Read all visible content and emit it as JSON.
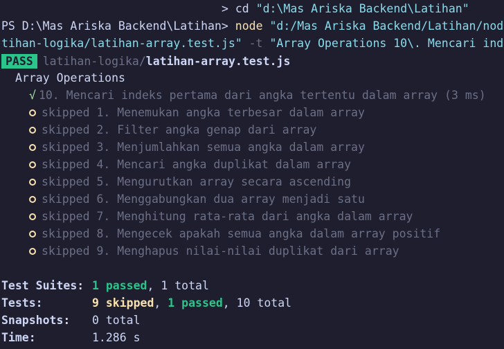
{
  "prompt": {
    "line1_cmd": "> cd",
    "line1_arg": "\"d:\\Mas Ariska Backend\\Latihan\"",
    "ps_prompt": "PS D:\\Mas Ariska Backend\\Latihan>",
    "node_cmd": "node",
    "node_arg": "\"d:/Mas Ariska Backend/Latihan/nod",
    "wrap_arg": "tihan-logika/latihan-array.test.js\"",
    "flag": " -t ",
    "flag_arg": "\"Array Operations 10\\. Mencari ind"
  },
  "result": {
    "badge": "PASS",
    "path_dir": "latihan-logika/",
    "path_file": "latihan-array.test.js",
    "suite_name": "Array Operations",
    "passed_test": "10. Mencari indeks pertama dari angka tertentu dalam array (3 ms)",
    "check_glyph": "√",
    "skipped_prefix": "skipped",
    "skipped_tests": [
      "1. Menemukan angka terbesar dalam array",
      "2. Filter angka genap dari array",
      "3. Menjumlahkan semua angka dalam array",
      "4. Mencari angka duplikat dalam array",
      "5. Mengurutkan array secara ascending",
      "6. Menggabungkan dua array menjadi satu",
      "7. Menghitung rata-rata dari angka dalam array",
      "8. Mengecek apakah semua angka dalam array positif",
      "9. Menghapus nilai-nilai duplikat dari array"
    ]
  },
  "summary": {
    "suites_label": "Test Suites:",
    "suites_passed": "1 passed",
    "suites_rest": ", 1 total",
    "tests_label": "Tests:",
    "tests_skipped": "9 skipped",
    "tests_sep": ", ",
    "tests_passed": "1 passed",
    "tests_rest": ", 10 total",
    "snapshots_label": "Snapshots:",
    "snapshots_value": "0 total",
    "time_label": "Time:",
    "time_value": "1.286 s"
  },
  "colors": {
    "background": "#1e1e2e",
    "pass_badge": "#2bc48a",
    "command_yellow": "#f9e2af",
    "string_cyan": "#89dceb"
  }
}
